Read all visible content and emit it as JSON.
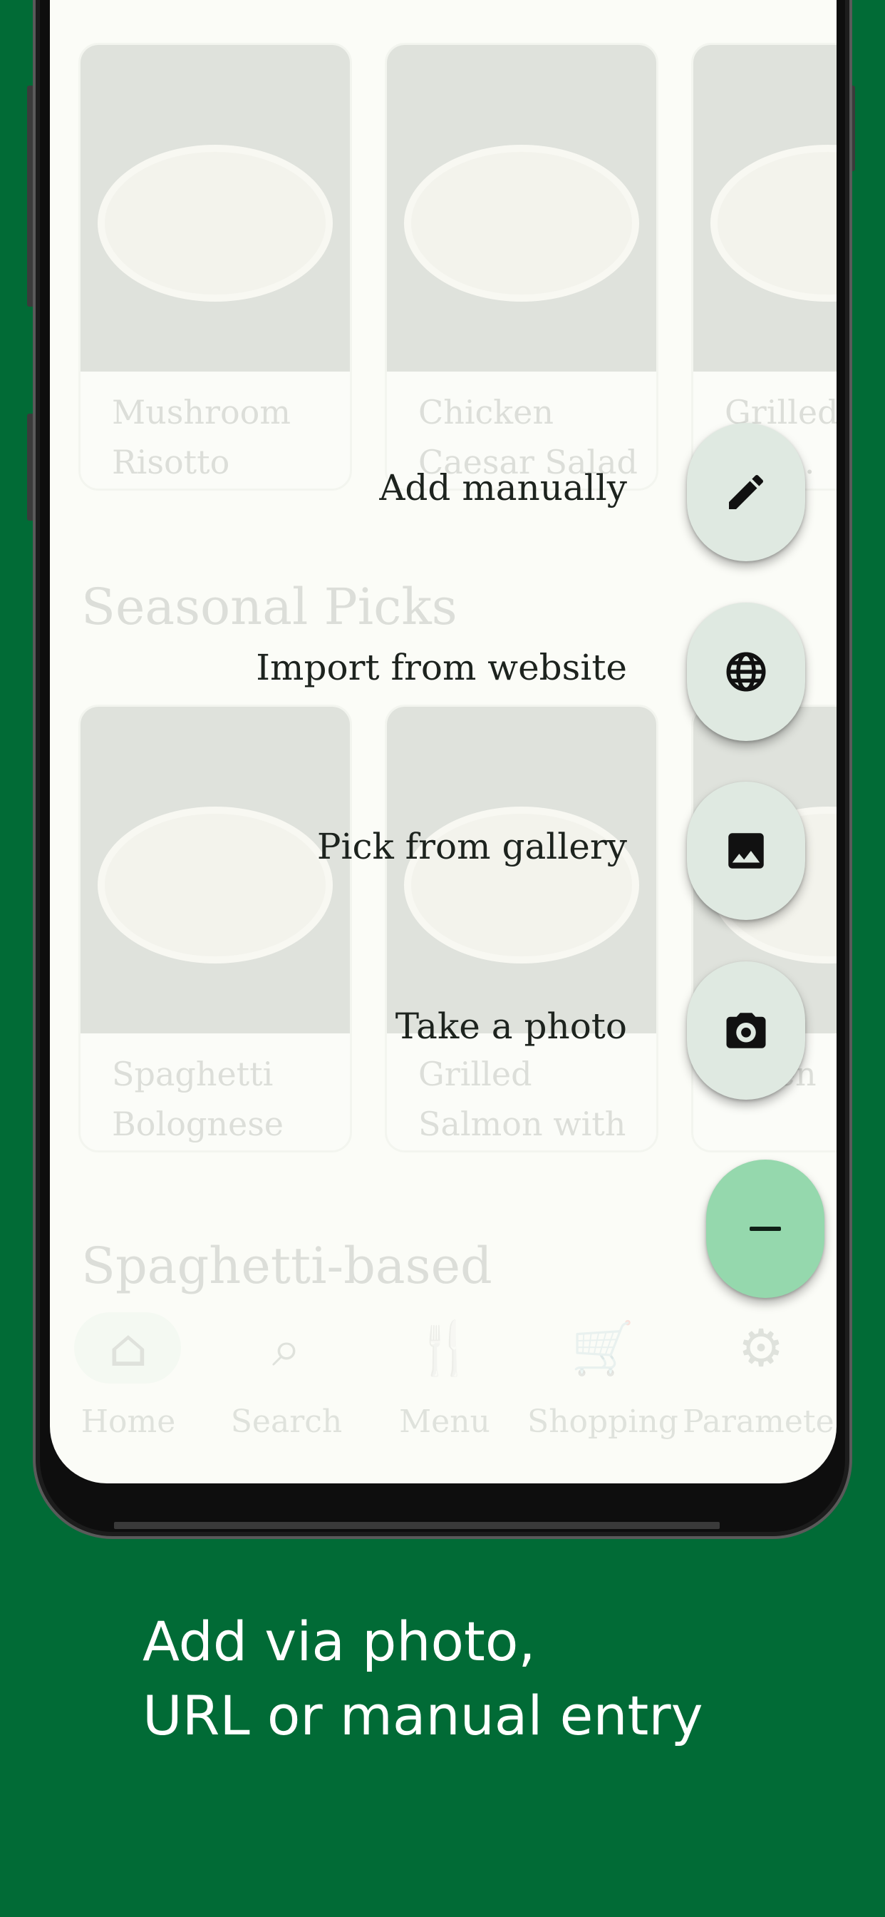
{
  "screen": {
    "rows": [
      {
        "section_title": "",
        "cards": [
          {
            "title": "Mushroom Risotto"
          },
          {
            "title": "Chicken Caesar Salad"
          },
          {
            "title": "Grilled S... Bro..."
          }
        ]
      },
      {
        "section_title": "Seasonal Picks",
        "cards": [
          {
            "title": "Spaghetti Bolognese"
          },
          {
            "title": "Grilled Salmon with Broccoli"
          },
          {
            "title": "...ken"
          }
        ]
      }
    ],
    "next_section_title": "Spaghetti-based"
  },
  "nav": {
    "items": [
      {
        "label": "Home",
        "icon": "home-icon",
        "active": true
      },
      {
        "label": "Search",
        "icon": "search-icon"
      },
      {
        "label": "Menu",
        "icon": "utensils-icon"
      },
      {
        "label": "Shopping",
        "icon": "cart-icon"
      },
      {
        "label": "Paramete...",
        "icon": "gear-icon"
      }
    ]
  },
  "speed_dial": {
    "actions": [
      {
        "label": "Add manually",
        "icon": "pencil-icon"
      },
      {
        "label": "Import from website",
        "icon": "globe-icon"
      },
      {
        "label": "Pick from gallery",
        "icon": "image-icon"
      },
      {
        "label": "Take a photo",
        "icon": "camera-icon"
      }
    ],
    "main_icon": "minus-icon"
  },
  "caption": {
    "line1": "Add via photo,",
    "line2": "URL or manual entry"
  },
  "colors": {
    "background": "#016b36",
    "fab_primary": "#95d8ad",
    "fab_secondary": "#dfe9e1"
  }
}
